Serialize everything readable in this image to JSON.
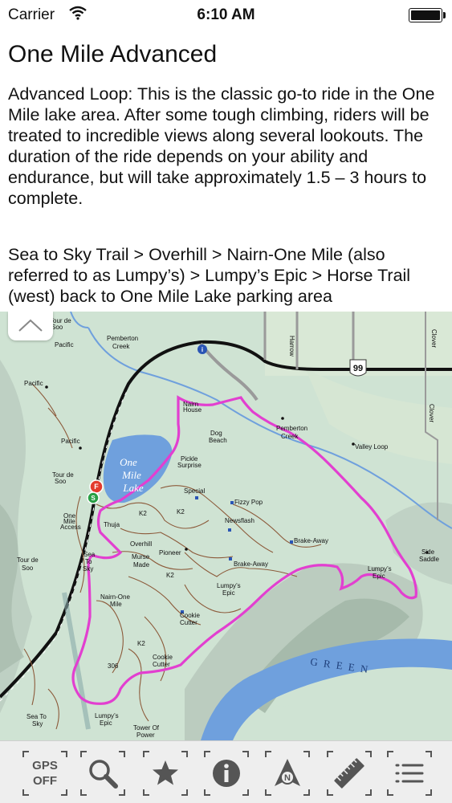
{
  "status_bar": {
    "carrier": "Carrier",
    "time": "6:10 AM"
  },
  "trail": {
    "title": "One Mile Advanced",
    "description": "Advanced Loop: This is the classic go-to ride in the One Mile lake area. After some tough climbing, riders will be treated to incredible views along several lookouts. The duration of the ride depends on your ability and endurance, but will take approximately 1.5 – 3 hours to complete.",
    "route": "Sea to Sky Trail > Overhill > Nairn-One Mile (also referred to as Lumpy’s) > Lumpy’s Epic > Horse Trail (west) back to One Mile Lake parking area"
  },
  "map": {
    "route_color": "#e23fd0",
    "lake_color": "#6fa0dd",
    "river_color": "#6fa0dd",
    "land_color": "#cfe3d3",
    "labels": {
      "pemberton_creek_1": "Pemberton",
      "pemberton_creek_1b": "Creek",
      "pacific_1": "Pacific",
      "pacific_2": "Pacific",
      "pacific_3": "Pacific",
      "tour_de_soo_1": "Tour de",
      "tour_de_soo_1b": "Soo",
      "tour_de_soo_2": "Tour de",
      "tour_de_soo_2b": "Soo",
      "tour_de_soo_3": "Tour de",
      "tour_de_soo_3b": "Soo",
      "lake_1": "One",
      "lake_2": "Mile",
      "lake_3": "Lake",
      "dog_beach_1": "Dog",
      "dog_beach_2": "Beach",
      "pemberton_creek_2": "Pemberton",
      "pemberton_creek_2b": "Creek",
      "valley_loop": "Valley Loop",
      "pickle_surprise_1": "Pickle",
      "pickle_surprise_2": "Surprise",
      "special_k": "Special",
      "fizzy_pop": "Fizzy Pop",
      "newsflash": "Newsflash",
      "brake_away_1": "Brake-Away",
      "brake_away_2": "Brake-Away",
      "k2_1": "K2",
      "k2_2": "K2",
      "k2_3": "K2",
      "k2_4": "K2",
      "thuja": "Thuja",
      "one_mile_access_1": "One",
      "one_mile_access_2": "Mile",
      "one_mile_access_3": "Access",
      "overhill": "Overhill",
      "pioneer": "Pioneer",
      "murse_made_1": "Murse",
      "murse_made_2": "Made",
      "sea_to_sky_1": "Sea",
      "sea_to_sky_2": "To",
      "sea_to_sky_3": "Sky",
      "sea_to_sky_4": "Sea To",
      "sea_to_sky_5": "Sky",
      "nairn_one_mile_1": "Nairn-One",
      "nairn_one_mile_2": "Mile",
      "lumpys_epic_1": "Lumpy’s",
      "lumpys_epic_1b": "Epic",
      "lumpys_epic_2": "Lumpy’s",
      "lumpys_epic_2b": "Epic",
      "lumpys_epic_3": "Lumpy’s",
      "lumpys_epic_3b": "Epic",
      "cookie_cutter_1": "Cookie",
      "cookie_cutter_1b": "Cutter",
      "cookie_cutter_2": "Cookie",
      "cookie_cutter_2b": "Cutter",
      "tower_of_power_1": "Tower Of",
      "tower_of_power_2": "Power",
      "side_saddle_1": "Side",
      "side_saddle_2": "Saddle",
      "green": "G R E E N",
      "highway": "99",
      "road_306": "306",
      "harrow": "Harrow",
      "clover_1": "Clover",
      "clover_2": "Clover",
      "nairn_house_1": "Nairn",
      "nairn_house_2": "House"
    }
  },
  "toolbar": {
    "gps_line1": "GPS",
    "gps_line2": "OFF"
  }
}
